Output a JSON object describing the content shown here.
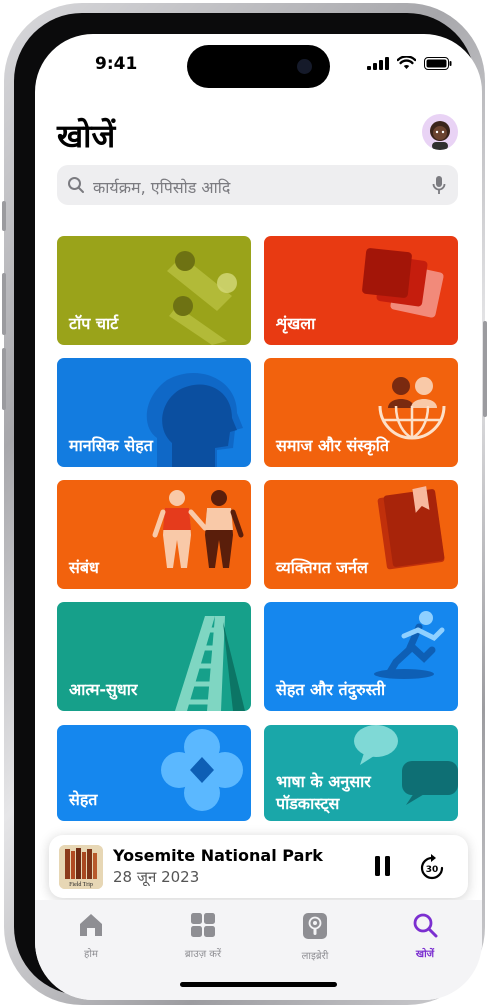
{
  "status": {
    "time": "9:41"
  },
  "header": {
    "title": "खोजें"
  },
  "search": {
    "placeholder": "कार्यक्रम, एपिसोड आदि"
  },
  "categories": [
    {
      "label": "टॉप चार्ट",
      "color": "#9aa31a"
    },
    {
      "label": "शृंखला",
      "color": "#e83a12"
    },
    {
      "label": "मानसिक सेहत",
      "color": "#137ce0"
    },
    {
      "label": "समाज और संस्कृति",
      "color": "#f2620d"
    },
    {
      "label": "संबंध",
      "color": "#f2620d"
    },
    {
      "label": "व्यक्तिगत जर्नल",
      "color": "#f2620d"
    },
    {
      "label": "आत्म-सुधार",
      "color": "#16a08a"
    },
    {
      "label": "सेहत और तंदुरुस्ती",
      "color": "#1587ee"
    },
    {
      "label": "सेहत",
      "color": "#1587ee"
    },
    {
      "label": "भाषा के अनुसार\nपॉडकास्ट्स",
      "line1": "भाषा के अनुसार",
      "line2": "पॉडकास्ट्स",
      "color": "#1aa7a9"
    }
  ],
  "mini_player": {
    "title": "Yosemite National Park",
    "subtitle": "28 जून 2023",
    "artwork_text": "Field Trip",
    "skip_seconds": "30"
  },
  "tabs": [
    {
      "label": "होम",
      "icon": "house-icon"
    },
    {
      "label": "ब्राउज़ करें",
      "icon": "grid-icon"
    },
    {
      "label": "लाइब्रेरी",
      "icon": "podcast-icon"
    },
    {
      "label": "खोजें",
      "icon": "search-icon",
      "active": true
    }
  ],
  "colors": {
    "accent": "#7b2fd0",
    "tab_inactive": "#8e8e93"
  }
}
